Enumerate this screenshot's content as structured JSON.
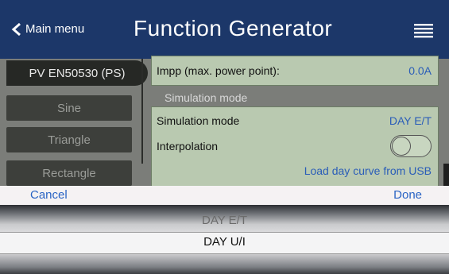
{
  "header": {
    "back_label": "Main menu",
    "title": "Function Generator"
  },
  "sidebar": {
    "items": [
      {
        "label": "PV EN50530 (PS)",
        "active": true
      },
      {
        "label": "Sine",
        "active": false
      },
      {
        "label": "Triangle",
        "active": false
      },
      {
        "label": "Rectangle",
        "active": false
      }
    ]
  },
  "panel_top": {
    "impp_label": "Impp (max. power point):",
    "impp_value": "0.0A"
  },
  "simulation": {
    "section_label": "Simulation mode",
    "mode_label": "Simulation mode",
    "mode_value": "DAY E/T",
    "interpolation_label": "Interpolation",
    "interpolation_on": false,
    "load_link": "Load day curve from USB"
  },
  "picker": {
    "cancel_label": "Cancel",
    "done_label": "Done",
    "options": [
      "DAY E/T",
      "DAY U/I"
    ],
    "selected": "DAY U/I"
  },
  "colors": {
    "header_bg": "#1c3769",
    "panel_bg": "#b9c9b0",
    "value_blue": "#2a5db8",
    "link_blue": "#2a64c4"
  }
}
